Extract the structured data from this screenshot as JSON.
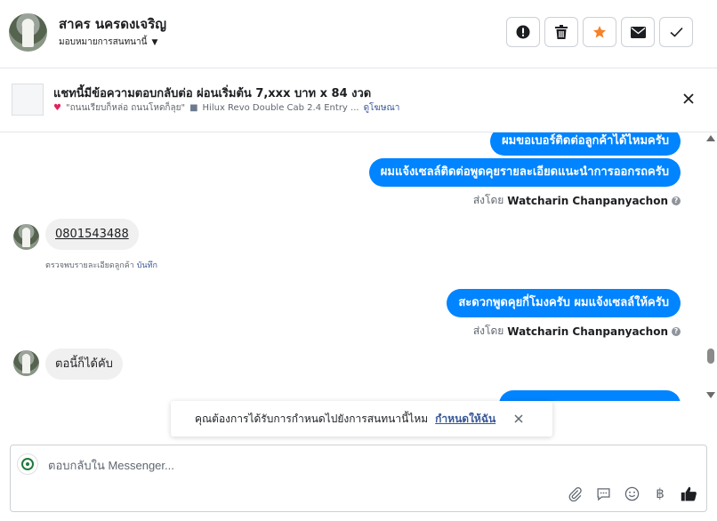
{
  "header": {
    "contact_name": "สาคร นครดงเจริญ",
    "assign_label": "มอบหมายการสนทนานี้"
  },
  "ad": {
    "title": "แชทนี้มีข้อความตอบกลับต่อ ผ่อนเริ่มต้น 7,xxx บาท x 84 งวด",
    "subtitle_quote": "\"ถนนเรียบก็หล่อ ถนนโหดก็ลุย\"",
    "subtitle_product": "Hilux Revo Double Cab 2.4 Entry ...",
    "view_ad_link": "ดูโฆษณา"
  },
  "messages": {
    "out1": "ผมขอเบอร์ติดต่อลูกค้าได้ไหมครับ",
    "out2": "ผมแจ้งเซลล์ติดต่อพูดคุยรายละเอียดแนะนำการออกรถครับ",
    "sent_by_prefix": "ส่งโดย",
    "sent_by_name": "Watcharin Chanpanyachon",
    "in1_phone": "0801543488",
    "detected_note": "ตรวจพบรายละเอียดลูกค้า",
    "save_link": "บันทึก",
    "out3": "สะดวกพูดคุยกี่โมงครับ ผมแจ้งเซลล์ให้ครับ",
    "in2": "ตอนี้ก็ได้คับ"
  },
  "toast": {
    "text": "คุณต้องการได้รับการกำหนดไปยังการสนทนานี้ไหม",
    "link": "กำหนดให้ฉัน"
  },
  "composer": {
    "placeholder": "ตอบกลับใน Messenger..."
  },
  "colors": {
    "accent_blue": "#0084ff",
    "link_blue": "#385898",
    "star_orange": "#f5822a"
  }
}
